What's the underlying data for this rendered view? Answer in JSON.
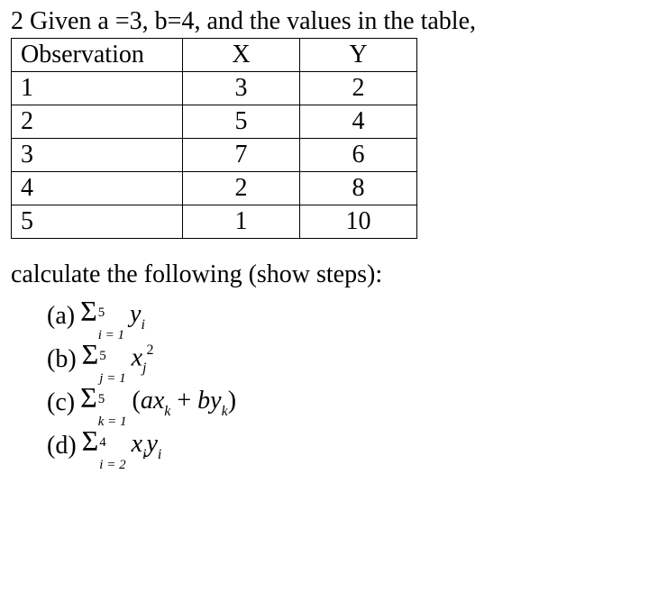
{
  "intro": "2 Given a =3, b=4, and the values in the table,",
  "table": {
    "headers": {
      "obs": "Observation",
      "x": "X",
      "y": "Y"
    },
    "rows": [
      {
        "obs": "1",
        "x": "3",
        "y": "2"
      },
      {
        "obs": "2",
        "x": "5",
        "y": "4"
      },
      {
        "obs": "3",
        "x": "7",
        "y": "6"
      },
      {
        "obs": "4",
        "x": "2",
        "y": "8"
      },
      {
        "obs": "5",
        "x": "1",
        "y": "10"
      }
    ]
  },
  "calc_prompt": "calculate the following (show steps):",
  "questions": {
    "a": {
      "label": "(a)",
      "upper": "5",
      "lower": "i = 1",
      "expr_var": "y",
      "expr_sub": "i"
    },
    "b": {
      "label": "(b)",
      "upper": "5",
      "lower": "j = 1",
      "expr_var": "x",
      "expr_sub": "j",
      "expr_sup": "2"
    },
    "c": {
      "label": "(c)",
      "upper": "5",
      "lower": "k = 1",
      "open": "(",
      "a": "a",
      "v1": "x",
      "s1": "k",
      "plus": " + ",
      "b": "b",
      "v2": "y",
      "s2": "k",
      "close": ")"
    },
    "d": {
      "label": "(d)",
      "upper": "4",
      "lower": "i = 2",
      "v1": "x",
      "s1": "i",
      "v2": "y",
      "s2": "i"
    }
  }
}
